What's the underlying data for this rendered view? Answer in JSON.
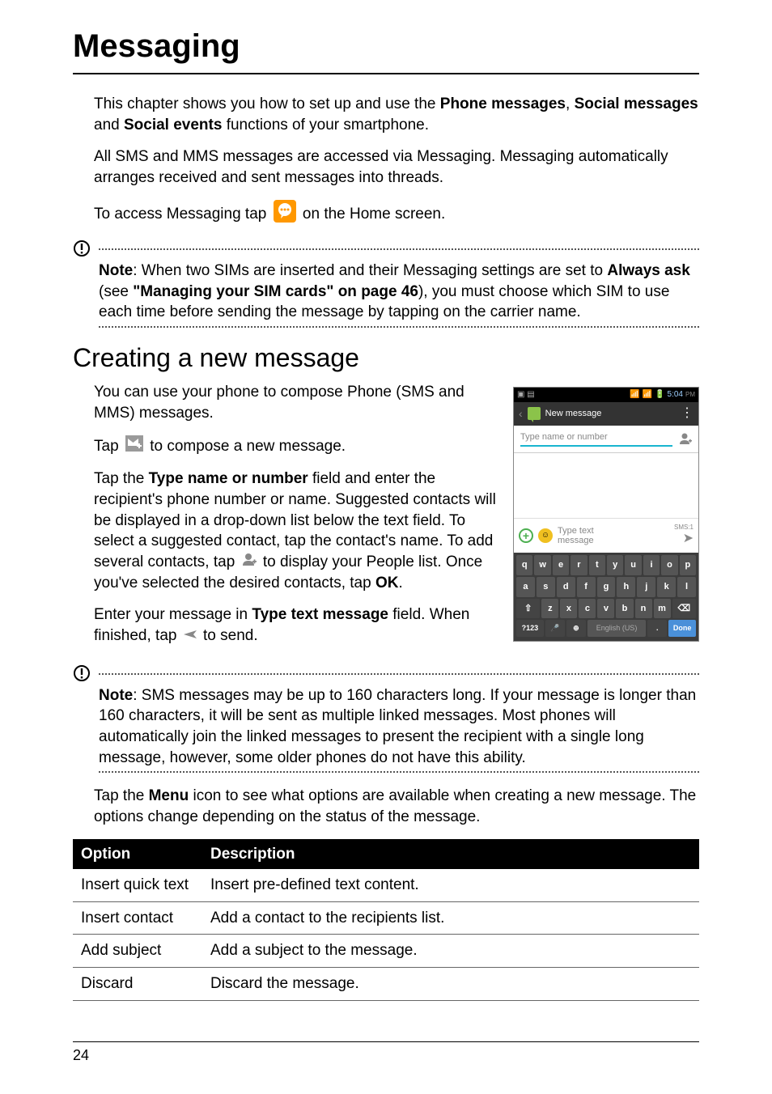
{
  "page": {
    "title": "Messaging",
    "number": "24"
  },
  "intro": {
    "p1_a": "This chapter shows you how to set up and use the ",
    "p1_b": "Phone messages",
    "p1_c": ", ",
    "p1_d": "Social messages",
    "p1_e": " and ",
    "p1_f": "Social events",
    "p1_g": " functions of your smartphone.",
    "p2": "All SMS and MMS messages are accessed via Messaging. Messaging automatically arranges received and sent messages into threads.",
    "p3_a": "To access Messaging tap ",
    "p3_b": " on the Home screen."
  },
  "note1": {
    "label": "Note",
    "a": ": When two SIMs are inserted and their Messaging settings are set to ",
    "b": "Always ask",
    "c": " (see ",
    "d": "\"Managing your SIM cards\" on page 46",
    "e": "), you must choose which SIM to use each time before sending the message by tapping on the carrier name."
  },
  "section": {
    "title": "Creating a new message",
    "p1": "You can use your phone to compose Phone (SMS and MMS) messages.",
    "p2_a": "Tap ",
    "p2_b": " to compose a new message.",
    "p3_a": "Tap the ",
    "p3_b": "Type name or number",
    "p3_c": " field and enter the recipient's phone number or name. Suggested contacts will be displayed in a drop-down list below the text field. To select a suggested contact, tap the contact's name. To add several contacts, tap ",
    "p3_d": " to display your People list. Once you've selected the desired contacts, tap ",
    "p3_e": "OK",
    "p3_f": ".",
    "p4_a": "Enter your message in ",
    "p4_b": "Type text message",
    "p4_c": " field. When finished, tap ",
    "p4_d": " to send."
  },
  "phone": {
    "status_time": "5:04",
    "status_pm": "PM",
    "title": "New message",
    "to_placeholder": "Type name or number",
    "compose_placeholder_l1": "Type text",
    "compose_placeholder_l2": "message",
    "sms_label": "SMS:1",
    "keys_row1": [
      "q",
      "w",
      "e",
      "r",
      "t",
      "y",
      "u",
      "i",
      "o",
      "p"
    ],
    "keys_row2": [
      "a",
      "s",
      "d",
      "f",
      "g",
      "h",
      "j",
      "k",
      "l"
    ],
    "keys_row3_shift": "⇧",
    "keys_row3": [
      "z",
      "x",
      "c",
      "v",
      "b",
      "n",
      "m"
    ],
    "keys_row3_del": "⌫",
    "keys_r4_sym": "?123",
    "keys_r4_mic": "🎤",
    "keys_r4_globe": "⊕",
    "keys_r4_space": "English (US)",
    "keys_r4_dot": ".",
    "keys_r4_done": "Done"
  },
  "note2": {
    "label": "Note",
    "text": ": SMS messages may be up to 160 characters long. If your message is longer than 160 characters, it will be sent as multiple linked messages. Most phones will automatically join the linked messages to present the recipient with a single long message, however, some older phones do not have this ability."
  },
  "section2": {
    "p1_a": "Tap the ",
    "p1_b": "Menu",
    "p1_c": " icon to see what options are available when creating a new message. The options change depending on the status of the message."
  },
  "table": {
    "h1": "Option",
    "h2": "Description",
    "rows": [
      {
        "opt": "Insert quick text",
        "desc": "Insert pre-defined text content."
      },
      {
        "opt": "Insert contact",
        "desc": "Add a contact to the recipients list."
      },
      {
        "opt": "Add subject",
        "desc": "Add a subject to the message."
      },
      {
        "opt": "Discard",
        "desc": "Discard the message."
      }
    ]
  }
}
